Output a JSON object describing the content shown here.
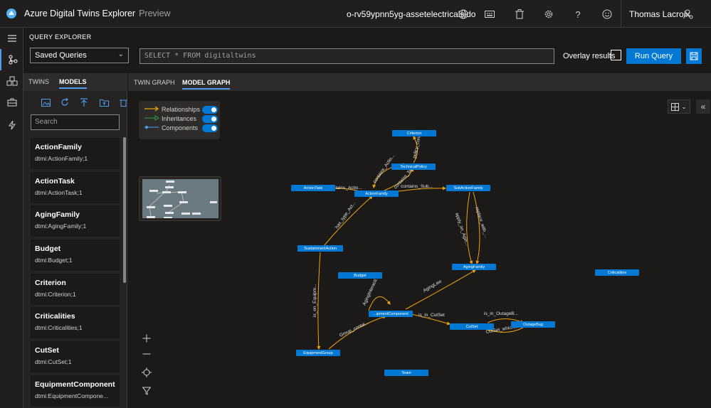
{
  "header": {
    "app_title": "Azure Digital Twins Explorer",
    "preview_label": "Preview",
    "environment": "o-rv59ypnn5yg-assetelectricalsido",
    "user_name": "Thomas Lacroix"
  },
  "query_explorer": {
    "title": "QUERY EXPLORER",
    "saved_queries_label": "Saved Queries",
    "query_text": "SELECT * FROM digitaltwins",
    "overlay_label": "Overlay results",
    "run_button": "Run Query"
  },
  "models_panel": {
    "tabs": [
      {
        "label": "TWINS",
        "active": false
      },
      {
        "label": "MODELS",
        "active": true
      }
    ],
    "search_placeholder": "Search",
    "models": [
      {
        "name": "ActionFamily",
        "id": "dtmi:ActionFamily;1"
      },
      {
        "name": "ActionTask",
        "id": "dtmi:ActionTask;1"
      },
      {
        "name": "AgingFamily",
        "id": "dtmi:AgingFamily;1"
      },
      {
        "name": "Budget",
        "id": "dtmi:Budget;1"
      },
      {
        "name": "Criterion",
        "id": "dtmi:Criterion;1"
      },
      {
        "name": "Criticalities",
        "id": "dtmi:Criticalities;1"
      },
      {
        "name": "CutSet",
        "id": "dtmi:CutSet;1"
      },
      {
        "name": "EquipmentComponent",
        "id": "dtmi:EquipmentCompone..."
      }
    ]
  },
  "graph_tabs": [
    {
      "label": "TWIN GRAPH",
      "active": false
    },
    {
      "label": "MODEL GRAPH",
      "active": true
    }
  ],
  "legend": {
    "relationships": "Relationships",
    "inheritances": "Inheritances",
    "components": "Components",
    "relationship_color": "#f0a30a",
    "inheritance_color": "#2ea043",
    "component_color": "#4f9cf0"
  },
  "graph": {
    "nodes": {
      "criterion": "Criterion",
      "technical_policy": "TechnicalPolicy",
      "action_task": "ActionTask",
      "action_family": "ActionFamily",
      "sub_action_family": "SubActionFamily",
      "sustainment_action": "SustainmentAction",
      "budget": "Budget",
      "aging_family": "AgingFamily",
      "criticalities": "Criticalities",
      "equipment_component": "...ipmentComponent",
      "cut_set": "CutSet",
      "outage_bag": "OutageBag",
      "equipment_group": "EquipmentGroup",
      "team": "Team"
    },
    "edges": {
      "contains_action_top": "contains_Actio...",
      "policy_contains": "policy_conta...",
      "contains_action_task": "contains_Actio...",
      "contains_sub": "contains_Sub...",
      "contains_tech": "contains_Tech...",
      "has_type_act": "has_type_Act...",
      "apply_on_agin": "apply_on_Agin...",
      "replace_with": "replace_with_...",
      "is_on_equipm": "is_on_Equipm...",
      "aging_interac": "AgingInteracti...",
      "aging_aw": "AgingLaw",
      "is_in_cutset": "is_in_CutSet",
      "is_in_outage": "is_in_OutageB...",
      "cutset_which": "CutSet_which...",
      "group_contai": "Group_contai..."
    }
  }
}
